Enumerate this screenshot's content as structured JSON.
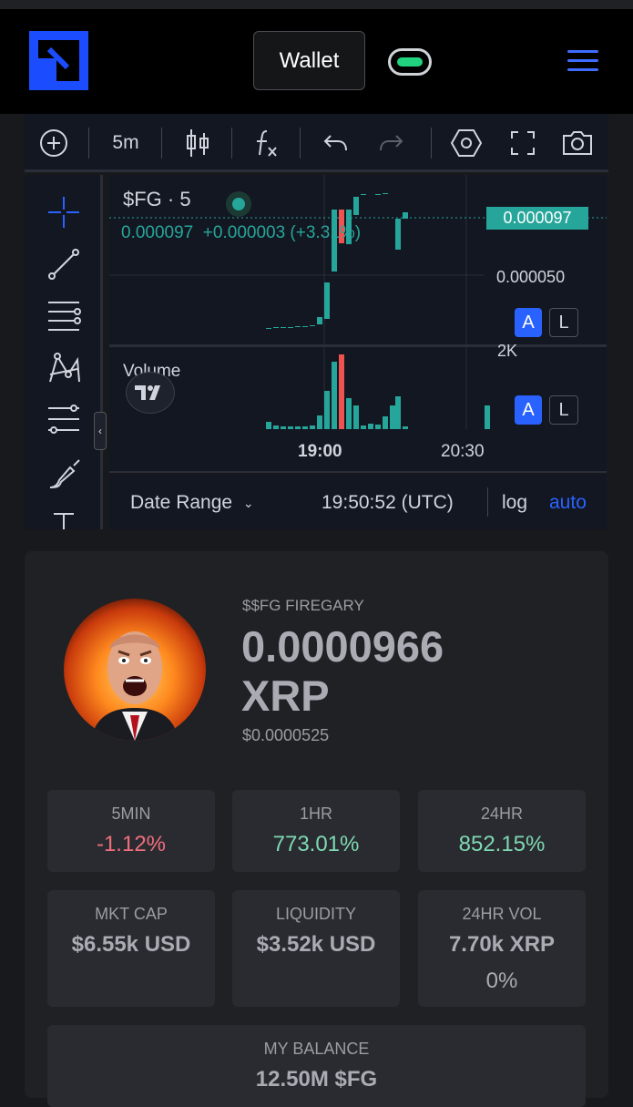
{
  "header": {
    "wallet_label": "Wallet",
    "accent": "#1b4dff",
    "toggle_color": "#21d37e"
  },
  "toolbar": {
    "interval": "5m",
    "icons": [
      "add-icon",
      "candles-icon",
      "indicators-icon",
      "undo-icon",
      "redo-icon",
      "settings-icon",
      "fullscreen-icon",
      "screenshot-icon"
    ]
  },
  "chart": {
    "symbol": "$FG · 5",
    "last_price": "0.000097",
    "change_line": "0.000097  +0.000003 (+3.31%)",
    "price_tag": "0.000097",
    "axis_mid": "0.000050",
    "volume_label": "Volume",
    "volume_axis": "2K",
    "time_tick_1": "19:00",
    "time_tick_2": "20:30",
    "scale_a": "A",
    "scale_l": "L",
    "date_range": "Date Range",
    "clock": "19:50:52 (UTC)",
    "log": "log",
    "auto": "auto",
    "up_color": "#26a69a",
    "down_color": "#ef5350"
  },
  "token": {
    "name": "$$FG FIREGARY",
    "price_line1": "0.0000966",
    "price_line2": "XRP",
    "usd_price": "$0.0000525"
  },
  "stats": {
    "min5_label": "5MIN",
    "min5_value": "-1.12%",
    "hr1_label": "1HR",
    "hr1_value": "773.01%",
    "hr24_label": "24HR",
    "hr24_value": "852.15%",
    "mktcap_label": "MKT CAP",
    "mktcap_value": "$6.55k USD",
    "liquidity_label": "LIQUIDITY",
    "liquidity_value": "$3.52k USD",
    "vol24_label": "24HR VOL",
    "vol24_value": "7.70k XRP",
    "vol24_sub": "0%",
    "balance_label": "MY BALANCE",
    "balance_value": "12.50M $FG",
    "negative_color": "#f06e7e",
    "positive_color": "#7ed9b2"
  }
}
